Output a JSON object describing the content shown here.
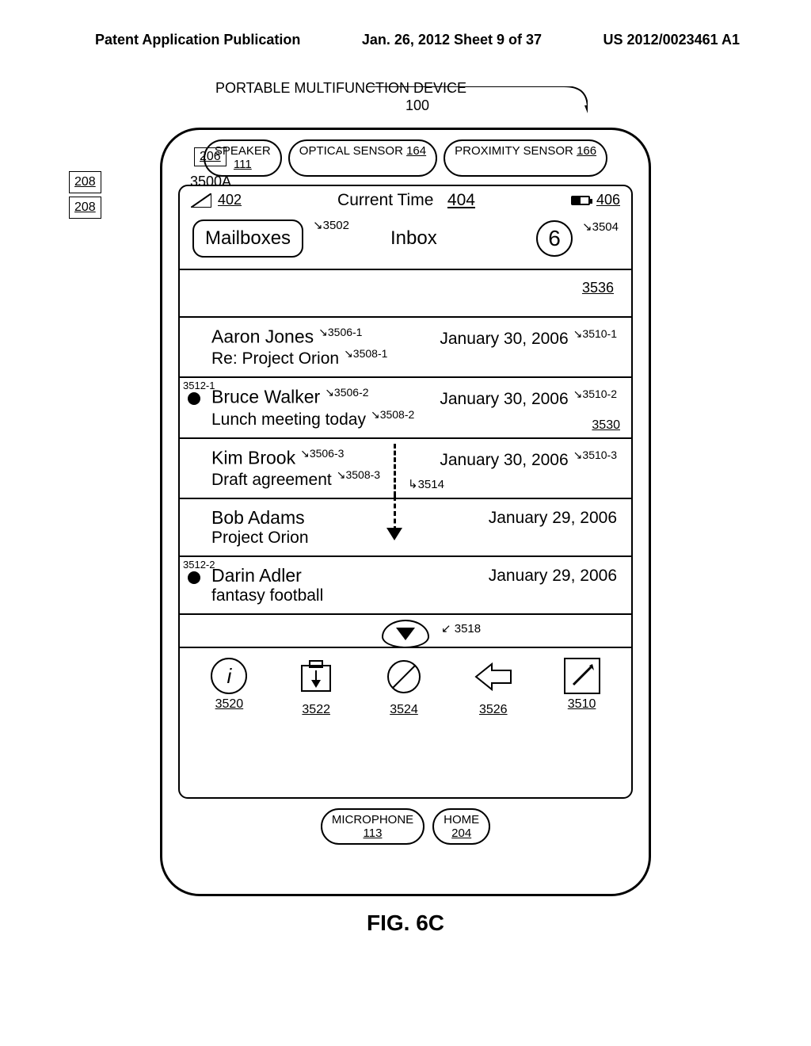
{
  "header": {
    "left": "Patent Application Publication",
    "center": "Jan. 26, 2012  Sheet 9 of 37",
    "right": "US 2012/0023461 A1"
  },
  "device": {
    "title": "PORTABLE MULTIFUNCTION DEVICE",
    "ref": "100",
    "side_top_box": "206",
    "side_boxes": [
      "208",
      "208"
    ],
    "screen_label": "3500A"
  },
  "sensors": {
    "speaker": {
      "label": "SPEAKER",
      "ref": "111"
    },
    "optical": {
      "label": "OPTICAL SENSOR",
      "ref": "164"
    },
    "proximity": {
      "label": "PROXIMITY SENSOR",
      "ref": "166"
    }
  },
  "status": {
    "signal_ref": "402",
    "time": "Current Time",
    "time_ref": "404",
    "battery_ref": "406"
  },
  "nav": {
    "back_label": "Mailboxes",
    "back_ref": "3502",
    "title": "Inbox",
    "count": "6",
    "count_ref": "3504"
  },
  "blank_row_ref": "3536",
  "messages": [
    {
      "sender": "Aaron Jones",
      "sender_ref": "3506-1",
      "subject": "Re: Project Orion",
      "subject_ref": "3508-1",
      "date": "January 30, 2006",
      "date_ref": "3510-1",
      "unread": false,
      "unread_ref": "",
      "row_bottom_ref": ""
    },
    {
      "sender": "Bruce Walker",
      "sender_ref": "3506-2",
      "subject": "Lunch meeting today",
      "subject_ref": "3508-2",
      "date": "January 30, 2006",
      "date_ref": "3510-2",
      "unread": true,
      "unread_ref": "3512-1",
      "row_bottom_ref": "3530"
    },
    {
      "sender": "Kim Brook",
      "sender_ref": "3506-3",
      "subject": "Draft agreement",
      "subject_ref": "3508-3",
      "date": "January 30, 2006",
      "date_ref": "3510-3",
      "unread": false,
      "unread_ref": "",
      "row_bottom_ref": ""
    },
    {
      "sender": "Bob Adams",
      "sender_ref": "",
      "subject": "Project Orion",
      "subject_ref": "",
      "date": "January 29, 2006",
      "date_ref": "",
      "unread": false,
      "unread_ref": "",
      "row_bottom_ref": ""
    },
    {
      "sender": "Darin Adler",
      "sender_ref": "",
      "subject": "fantasy football",
      "subject_ref": "",
      "date": "January 29, 2006",
      "date_ref": "",
      "unread": true,
      "unread_ref": "3512-2",
      "row_bottom_ref": ""
    }
  ],
  "scroll": {
    "gesture_ref": "3514",
    "down_ref": "3518"
  },
  "toolbar": [
    {
      "name": "info-button",
      "ref": "3520",
      "icon": "i",
      "shape": "circle"
    },
    {
      "name": "download-button",
      "ref": "3522",
      "icon": "↓",
      "shape": "square-tab"
    },
    {
      "name": "block-button",
      "ref": "3524",
      "icon": "⃠",
      "shape": "circle-slash"
    },
    {
      "name": "reply-button",
      "ref": "3526",
      "icon": "⇦",
      "shape": "arrow"
    },
    {
      "name": "compose-button",
      "ref": "3510",
      "icon": "✎",
      "shape": "square"
    }
  ],
  "bottom_sensors": {
    "mic": {
      "label": "MICROPHONE",
      "ref": "113"
    },
    "home": {
      "label": "HOME",
      "ref": "204"
    }
  },
  "figure_label": "FIG. 6C"
}
